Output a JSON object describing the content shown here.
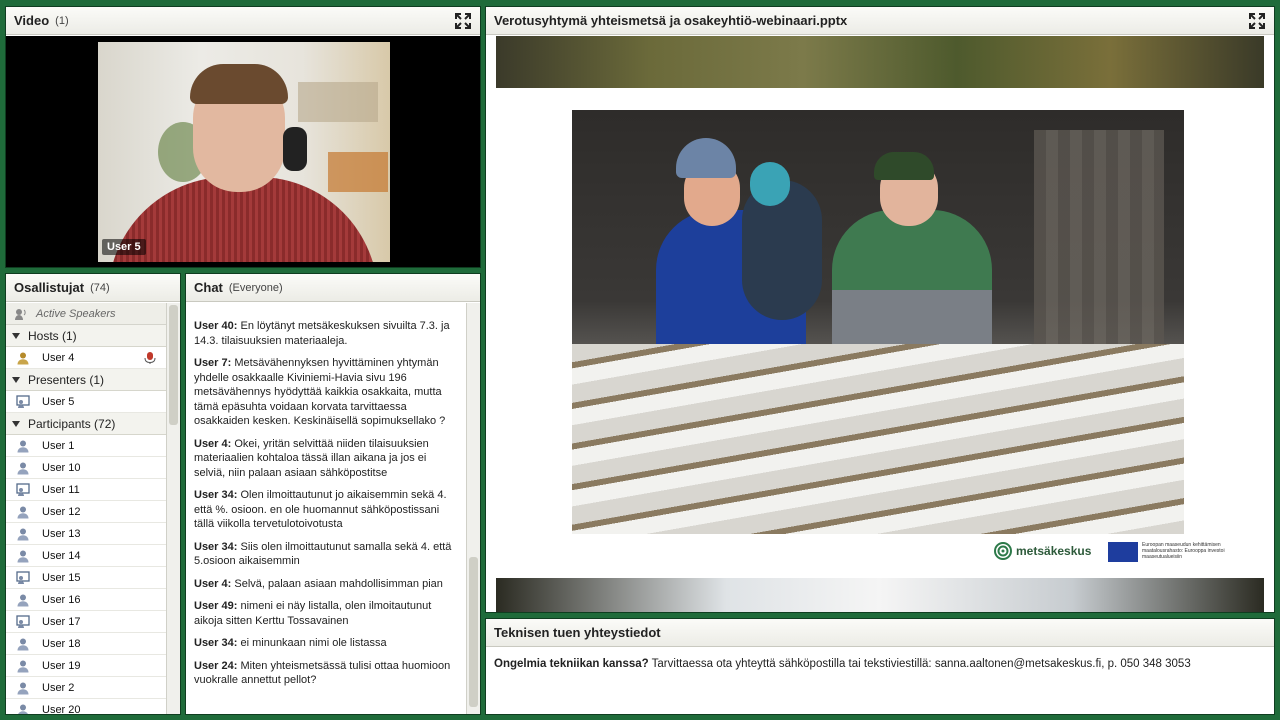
{
  "video_pod": {
    "title": "Video",
    "count": "(1)",
    "speaker_label": "User 5"
  },
  "attendees_pod": {
    "title": "Osallistujat",
    "count": "(74)",
    "active_speakers": "Active Speakers",
    "groups": [
      {
        "label": "Hosts (1)",
        "users": [
          "User 4"
        ]
      },
      {
        "label": "Presenters (1)",
        "users": [
          "User 5"
        ]
      },
      {
        "label": "Participants (72)",
        "users": [
          "User 1",
          "User 10",
          "User 11",
          "User 12",
          "User 13",
          "User 14",
          "User 15",
          "User 16",
          "User 17",
          "User 18",
          "User 19",
          "User 2",
          "User 20"
        ]
      }
    ]
  },
  "chat_pod": {
    "title": "Chat",
    "scope": "(Everyone)",
    "messages": [
      {
        "user": "User 40:",
        "text": "En löytänyt metsäkeskuksen sivuilta 7.3. ja 14.3. tilaisuuksien materiaaleja."
      },
      {
        "user": "User 7:",
        "text": "Metsävähennyksen hyvittäminen yhtymän yhdelle osakkaalle Kiviniemi-Havia sivu 196 metsävähennys hyödyttää kaikkia osakkaita, mutta tämä epäsuhta voidaan korvata tarvittaessa osakkaiden kesken. Keskinäisellä sopimuksellako ?"
      },
      {
        "user": "User 4:",
        "text": "Okei, yritän selvittää niiden tilaisuuksien materiaalien kohtaloa tässä illan aikana ja jos ei selviä, niin palaan asiaan sähköpostitse"
      },
      {
        "user": "User 34:",
        "text": "Olen ilmoittautunut jo aikaisemmin sekä 4. että %. osioon. en ole huomannut sähköpostissani tällä viikolla tervetulotoivotusta"
      },
      {
        "user": "User 34:",
        "text": "Siis olen ilmoittautunut samalla sekä 4. että 5.osioon aikaisemmin"
      },
      {
        "user": "User 4:",
        "text": "Selvä, palaan asiaan mahdollisimman pian"
      },
      {
        "user": "User 49:",
        "text": "nimeni ei näy listalla, olen ilmoitautunut aikoja sitten Kerttu Tossavainen"
      },
      {
        "user": "User 34:",
        "text": "ei minunkaan nimi ole listassa"
      },
      {
        "user": "User 24:",
        "text": "Miten yhteismetsässä tulisi ottaa huomioon vuokralle annettut pellot?"
      }
    ]
  },
  "share_pod": {
    "title": "Verotusyhtymä yhteismetsä ja osakeyhtiö-webinaari.pptx",
    "logo_text": "metsäkeskus",
    "eu_text": "Euroopan maaseudun kehittämisen maatalousrahasto: Eurooppa investoi maaseutualueisiin"
  },
  "notes_pod": {
    "title": "Teknisen tuen yhteystiedot",
    "bold": "Ongelmia tekniikan kanssa?",
    "text": " Tarvittaessa ota yhteyttä sähköpostilla tai tekstiviestillä: sanna.aaltonen@metsakeskus.fi, p. 050 348 3053"
  },
  "icons": {
    "fullscreen": "fullscreen-icon",
    "user": "user-icon",
    "presenter": "presenter-icon",
    "host": "host-icon",
    "mic": "microphone-icon",
    "speakers": "speakers-icon"
  },
  "colors": {
    "background": "#1f6b3a",
    "header": "#ecece6"
  }
}
